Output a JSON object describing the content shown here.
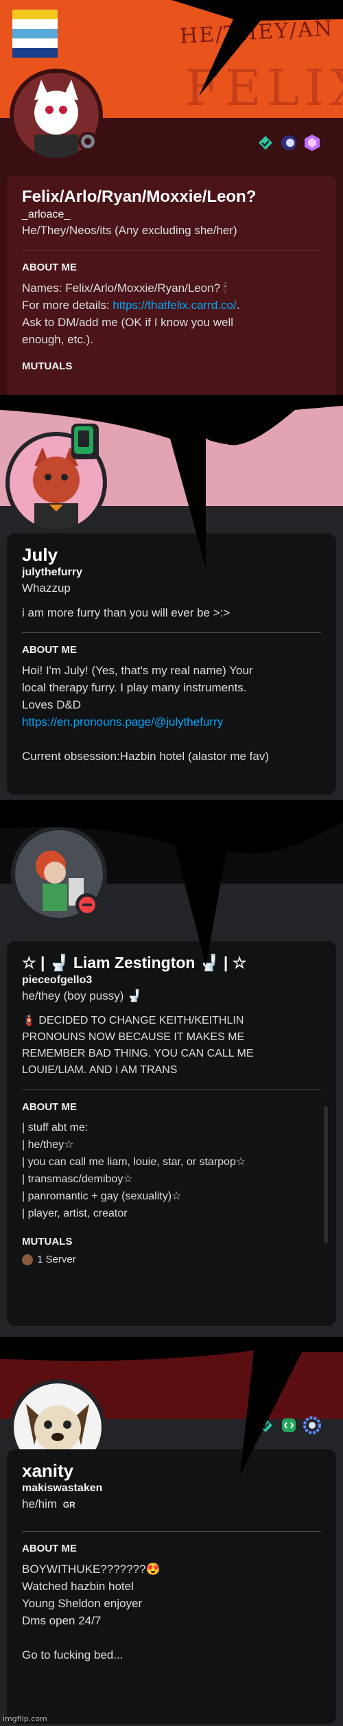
{
  "profiles": [
    {
      "banner_text": [
        "HE/THEY/AN",
        "FELIX"
      ],
      "badges": [
        "diamond-badge",
        "orb-badge",
        "hexagon-badge"
      ],
      "display_name": "Felix/Arlo/Ryan/Moxxie/Leon?",
      "username": "_arloace_",
      "pronouns": "He/They/Neos/its (Any excluding she/her)",
      "about_title": "ABOUT ME",
      "about_lines": [
        {
          "text": "Names: Felix/Arlo/Moxxie/Ryan/Leon? 🕯"
        },
        {
          "prefix": "For more details: ",
          "link": "https://thatfelix.carrd.co/",
          "suffix": "."
        },
        {
          "text": "Ask to DM/add me (OK if I know you well"
        },
        {
          "text": "enough, etc.)."
        }
      ],
      "mutuals_title": "MUTUALS"
    },
    {
      "display_name": "July",
      "username": "julythefurry",
      "pronouns": "Whazzup",
      "status": "i am more furry than you will ever be >:>",
      "about_title": "ABOUT ME",
      "about_lines": [
        {
          "text": "Hoi! I'm July! (Yes, that's my real name) Your"
        },
        {
          "text": "local therapy furry. I play many instruments."
        },
        {
          "text": "Loves D&D"
        },
        {
          "link": "https://en.pronouns.page/@julythefurry"
        },
        {
          "text": ""
        },
        {
          "text": "Current obsession:Hazbin hotel (alastor me fav)"
        }
      ]
    },
    {
      "display_name": "☆ | 🚽 Liam Zestington 🚽 | ☆",
      "username": "pieceofgello3",
      "pronouns": "he/they (boy pussy) 🚽",
      "status_lines": [
        "🧯 DECIDED TO CHANGE KEITH/KEITHLIN",
        "PRONOUNS NOW BECAUSE IT MAKES ME",
        "REMEMBER BAD THING. YOU CAN CALL ME",
        "LOUIE/LIAM. AND I AM TRANS"
      ],
      "about_title": "ABOUT ME",
      "about_lines": [
        {
          "text": "| stuff abt me:"
        },
        {
          "text": "| he/they☆"
        },
        {
          "text": "| you can call me liam, louie, star, or starpop☆"
        },
        {
          "text": "| transmasc/demiboy☆"
        },
        {
          "text": "| panromantic + gay (sexuality)☆"
        },
        {
          "text": "| player, artist, creator"
        }
      ],
      "mutuals_title": "MUTUALS",
      "mutual_servers": "1 Server"
    },
    {
      "badges": [
        "diamond-badge",
        "code-badge",
        "gear-badge"
      ],
      "display_name": "xanity",
      "username": "makiswastaken",
      "pronouns": "he/him",
      "pronoun_tag": "GR",
      "about_title": "ABOUT ME",
      "about_lines": [
        {
          "text": "BOYWITHUKE???????😍"
        },
        {
          "text": "Watched hazbin hotel"
        },
        {
          "text": "Young Sheldon enjoyer"
        },
        {
          "text": "Dms open 24/7"
        },
        {
          "text": ""
        },
        {
          "text": "Go to fucking bed..."
        }
      ]
    }
  ],
  "watermark": "imgflip.com",
  "colors": {
    "card_dark": "#1e1f22",
    "card_red": "#3b0d12",
    "link": "#00a8fc",
    "online": "#23a55a",
    "dnd": "#f23f43"
  }
}
